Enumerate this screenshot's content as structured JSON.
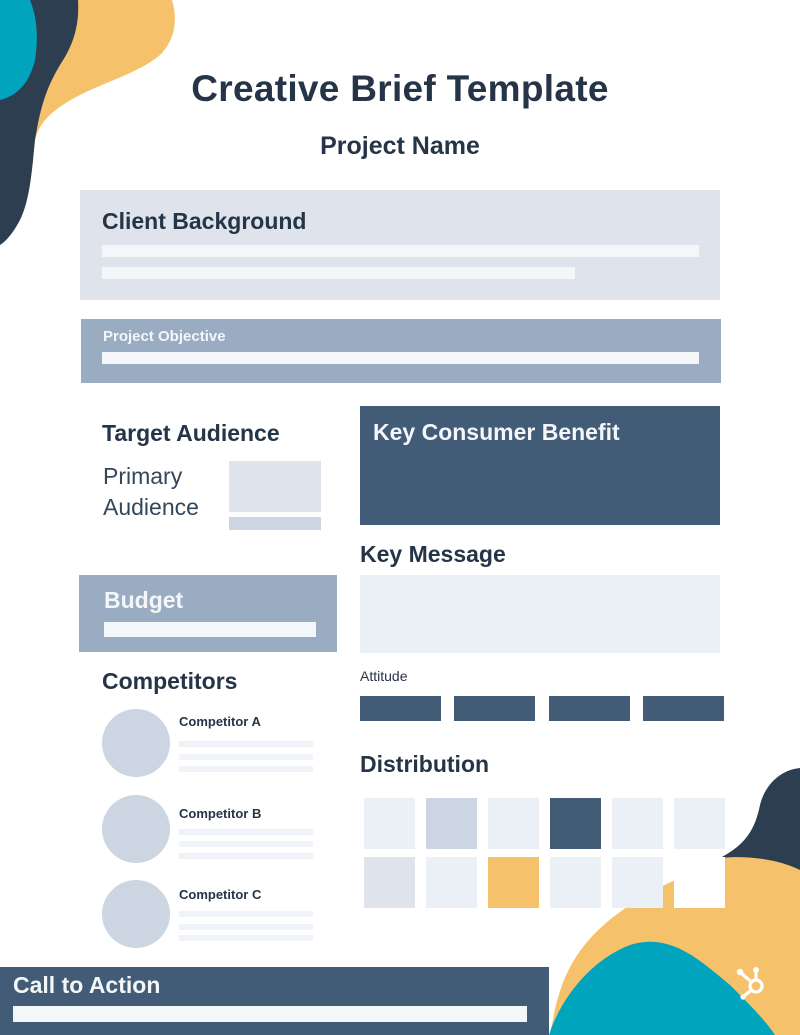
{
  "header": {
    "title": "Creative Brief Template",
    "subtitle": "Project Name"
  },
  "colors": {
    "navy": "#2d3e50",
    "slate": "#425b76",
    "steel": "#99acc2",
    "light": "#dfe3eb",
    "pale": "#eaf0f6",
    "teal": "#00a4bd",
    "gold": "#f5c26b",
    "text": "#253447"
  },
  "sections": {
    "client_background": {
      "title": "Client Background"
    },
    "project_objective": {
      "title": "Project Objective"
    },
    "target_audience": {
      "title": "Target Audience",
      "primary_label_line1": "Primary",
      "primary_label_line2": "Audience"
    },
    "budget": {
      "title": "Budget"
    },
    "competitors": {
      "title": "Competitors",
      "items": [
        {
          "name": "Competitor A"
        },
        {
          "name": "Competitor B"
        },
        {
          "name": "Competitor C"
        }
      ]
    },
    "key_consumer_benefit": {
      "title": "Key Consumer Benefit"
    },
    "key_message": {
      "title": "Key Message"
    },
    "attitude": {
      "title": "Attitude",
      "count": 4
    },
    "distribution": {
      "title": "Distribution",
      "cells": [
        [
          "pale",
          "grayblue",
          "pale",
          "slate",
          "pale",
          "pale"
        ],
        [
          "light",
          "pale",
          "gold",
          "pale",
          "pale",
          "white"
        ]
      ]
    },
    "call_to_action": {
      "title": "Call to Action"
    }
  },
  "branding": {
    "logo_icon": "hubspot-sprocket-icon"
  }
}
